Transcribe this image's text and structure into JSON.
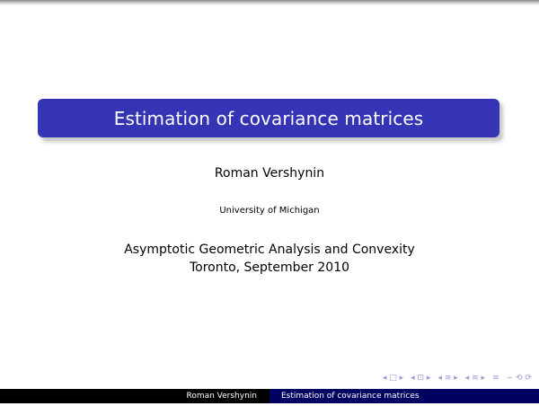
{
  "slide": {
    "title": "Estimation of covariance matrices",
    "author": "Roman Vershynin",
    "affiliation": "University of Michigan",
    "event_line1": "Asymptotic Geometric Analysis and Convexity",
    "event_line2": "Toronto, September 2010"
  },
  "navigation": {
    "symbols": [
      "◂ □ ▸",
      "◂ ⊡ ▸",
      "◂ ≡ ▸",
      "◂ ≡ ▸",
      "≡",
      "∽ ⟲ ⟳"
    ]
  },
  "footer": {
    "author": "Roman Vershynin",
    "title": "Estimation of covariance matrices"
  },
  "colors": {
    "title_box": "#3434b4",
    "footer_left": "#000000",
    "footer_right": "#000060",
    "nav_symbols": "#9c9cd0"
  }
}
